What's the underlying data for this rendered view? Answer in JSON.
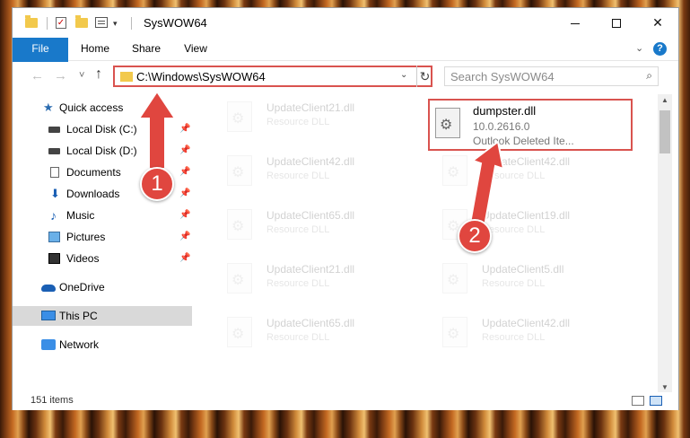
{
  "window": {
    "title": "SysWOW64",
    "quick_access_dropdown": "▾",
    "buttons": {
      "minimize": "",
      "maximize": "",
      "close": "✕"
    }
  },
  "ribbon": {
    "tabs": [
      "File",
      "Home",
      "Share",
      "View"
    ],
    "expand_icon": "⌄",
    "help": "?"
  },
  "nav": {
    "back": "←",
    "forward": "→",
    "recent": "˅",
    "up": "↑",
    "address": "C:\\Windows\\SysWOW64",
    "address_dropdown": "⌄",
    "refresh": "↻",
    "search_placeholder": "Search SysWOW64",
    "search_icon": "⌕"
  },
  "sidebar": {
    "items": [
      {
        "label": "Quick access",
        "icon": "star-icon",
        "pinned": false
      },
      {
        "label": "Local Disk (C:)",
        "icon": "disk-icon",
        "pinned": true
      },
      {
        "label": "Local Disk (D:)",
        "icon": "disk-icon",
        "pinned": true
      },
      {
        "label": "Documents",
        "icon": "document-icon",
        "pinned": true
      },
      {
        "label": "Downloads",
        "icon": "download-icon",
        "pinned": true
      },
      {
        "label": "Music",
        "icon": "music-icon",
        "pinned": true
      },
      {
        "label": "Pictures",
        "icon": "picture-icon",
        "pinned": true
      },
      {
        "label": "Videos",
        "icon": "video-icon",
        "pinned": true
      },
      {
        "label": "OneDrive",
        "icon": "cloud-icon",
        "pinned": false
      },
      {
        "label": "This PC",
        "icon": "computer-icon",
        "pinned": false,
        "selected": true
      },
      {
        "label": "Network",
        "icon": "network-icon",
        "pinned": false
      }
    ],
    "pin_glyph": "📌"
  },
  "files": {
    "highlighted": {
      "name": "dumpster.dll",
      "version": "10.0.2616.0",
      "description": "Outlook Deleted Ite..."
    },
    "faded": [
      {
        "name": "UpdateClient21.dll",
        "type": "Resource DLL"
      },
      {
        "name": "UpdateClient42.dll",
        "type": "Resource DLL"
      },
      {
        "name": "UpdateClient42.dll",
        "type": "Resource DLL"
      },
      {
        "name": "UpdateClient65.dll",
        "type": "Resource DLL"
      },
      {
        "name": "UpdateClient19.dll",
        "type": "Resource DLL"
      },
      {
        "name": "UpdateClient21.dll",
        "type": "Resource DLL"
      },
      {
        "name": "UpdateClient5.dll",
        "type": "Resource DLL"
      },
      {
        "name": "UpdateClient65.dll",
        "type": "Resource DLL"
      },
      {
        "name": "UpdateClient42.dll",
        "type": "Resource DLL"
      }
    ]
  },
  "status": {
    "item_count": "151 items"
  },
  "annotations": {
    "badge1": "1",
    "badge2": "2",
    "color": "#e0463f"
  }
}
